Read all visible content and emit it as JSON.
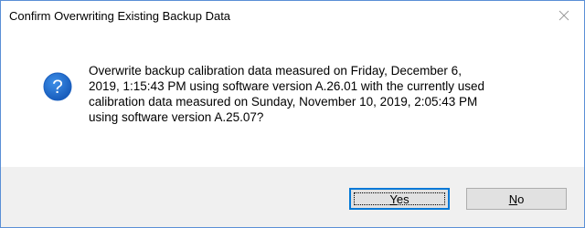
{
  "dialog": {
    "title": "Confirm Overwriting Existing Backup Data",
    "close_icon": "close-icon",
    "icon": "question-icon",
    "accent_color": "#0078d7",
    "icon_color": "#1e6fd9",
    "message_lines": [
      "Overwrite backup calibration data measured on Friday, December 6,",
      "2019, 1:15:43 PM using software version A.26.01 with the currently used",
      "calibration data measured on Sunday, November 10, 2019, 2:05:43 PM",
      "using software version A.25.07?"
    ]
  },
  "buttons": {
    "yes": {
      "mnemonic": "Y",
      "rest": "es"
    },
    "no": {
      "mnemonic": "N",
      "rest": "o"
    }
  }
}
